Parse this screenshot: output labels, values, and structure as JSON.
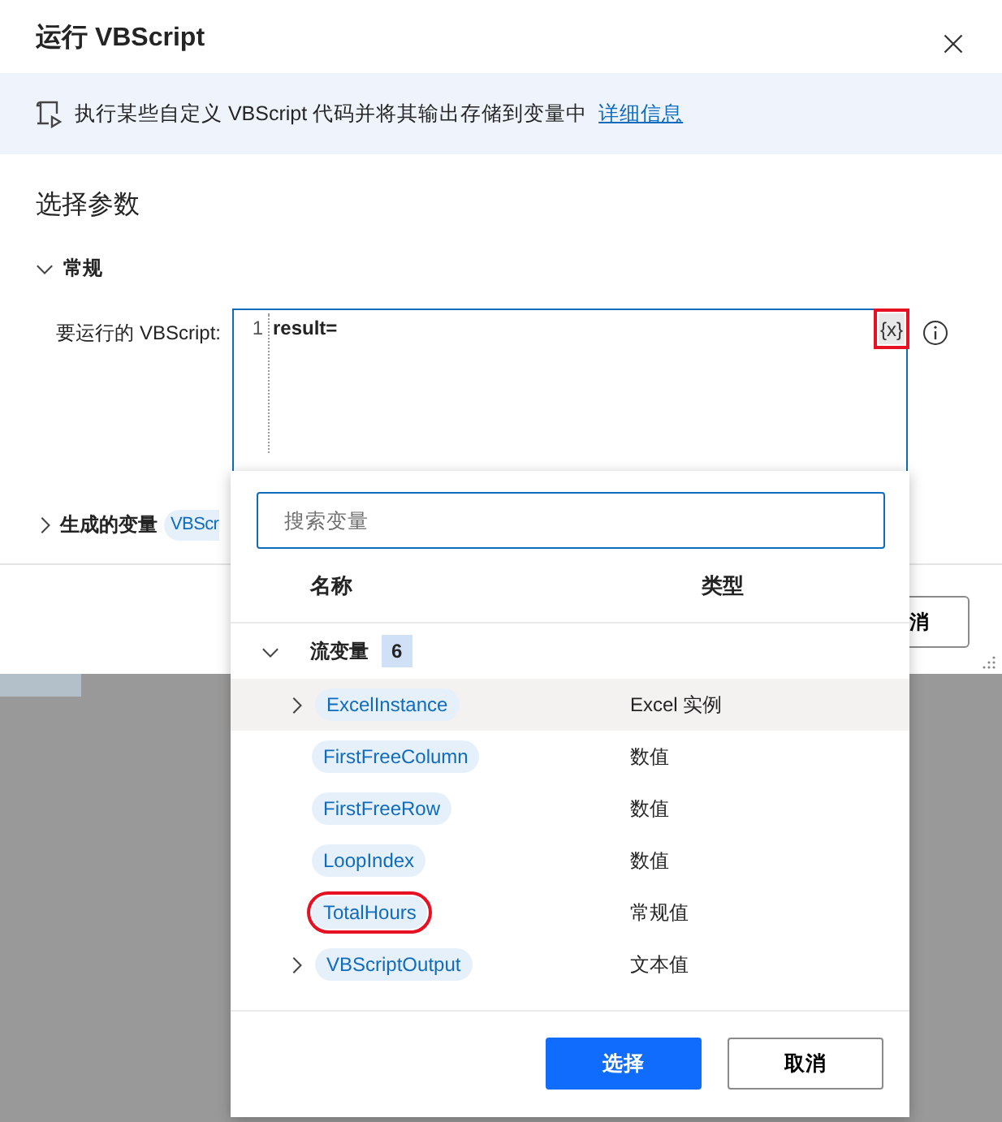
{
  "dialog": {
    "title": "运行 VBScript",
    "info": {
      "text": "执行某些自定义 VBScript 代码并将其输出存储到变量中",
      "link": "详细信息"
    },
    "heading": "选择参数",
    "general_section": {
      "title": "常规",
      "expanded": true,
      "field": {
        "label": "要运行的 VBScript:",
        "line_numbers": [
          "1"
        ],
        "code": "result=",
        "variable_button": {
          "label": "{x}",
          "highlighted": true
        }
      }
    },
    "output_section": {
      "title": "生成的变量",
      "expanded": false,
      "chips": [
        "VBScr"
      ]
    },
    "footer_buttons": [
      "消"
    ]
  },
  "variable_picker": {
    "search": {
      "placeholder": "搜索变量"
    },
    "columns": [
      "名称",
      "类型"
    ],
    "group": {
      "label": "流变量",
      "count": "6",
      "expanded": true,
      "variables": [
        {
          "name": "ExcelInstance",
          "type": "Excel 实例",
          "expandable": true,
          "hovered": true,
          "highlighted": false
        },
        {
          "name": "FirstFreeColumn",
          "type": "数值",
          "expandable": false,
          "hovered": false,
          "highlighted": false
        },
        {
          "name": "FirstFreeRow",
          "type": "数值",
          "expandable": false,
          "hovered": false,
          "highlighted": false
        },
        {
          "name": "LoopIndex",
          "type": "数值",
          "expandable": false,
          "hovered": false,
          "highlighted": false
        },
        {
          "name": "TotalHours",
          "type": "常规值",
          "expandable": false,
          "hovered": false,
          "highlighted": true
        },
        {
          "name": "VBScriptOutput",
          "type": "文本值",
          "expandable": true,
          "hovered": false,
          "highlighted": false
        }
      ]
    },
    "buttons": [
      {
        "label": "选择",
        "kind": "primary"
      },
      {
        "label": "取消",
        "kind": "secondary"
      }
    ]
  }
}
